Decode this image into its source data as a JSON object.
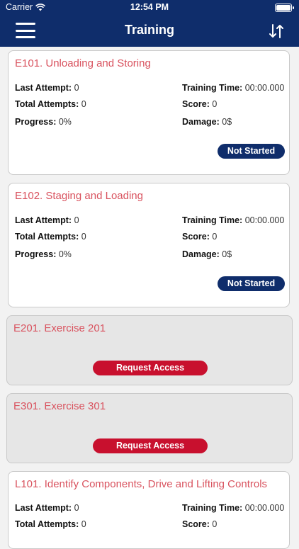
{
  "status_bar": {
    "carrier": "Carrier",
    "time": "12:54 PM"
  },
  "header": {
    "title": "Training"
  },
  "colors": {
    "nav": "#0f2d6b",
    "title_red": "#d9535f",
    "button_red": "#c8102e"
  },
  "labels": {
    "last_attempt": "Last Attempt:",
    "total_attempts": "Total Attempts:",
    "progress": "Progress:",
    "training_time": "Training Time:",
    "score": "Score:",
    "damage": "Damage:"
  },
  "cards": [
    {
      "title": "E101. Unloading and Storing",
      "last_attempt": "0",
      "total_attempts": "0",
      "progress": "0%",
      "training_time": "00:00.000",
      "score": "0",
      "damage": "0$",
      "status": "Not Started"
    },
    {
      "title": "E102. Staging and Loading",
      "last_attempt": "0",
      "total_attempts": "0",
      "progress": "0%",
      "training_time": "00:00.000",
      "score": "0",
      "damage": "0$",
      "status": "Not Started"
    },
    {
      "title": "E201. Exercise 201",
      "button": "Request Access"
    },
    {
      "title": "E301. Exercise 301",
      "button": "Request Access"
    },
    {
      "title": "L101. Identify Components, Drive and Lifting Controls",
      "last_attempt": "0",
      "total_attempts": "0",
      "training_time": "00:00.000",
      "score": "0"
    }
  ]
}
